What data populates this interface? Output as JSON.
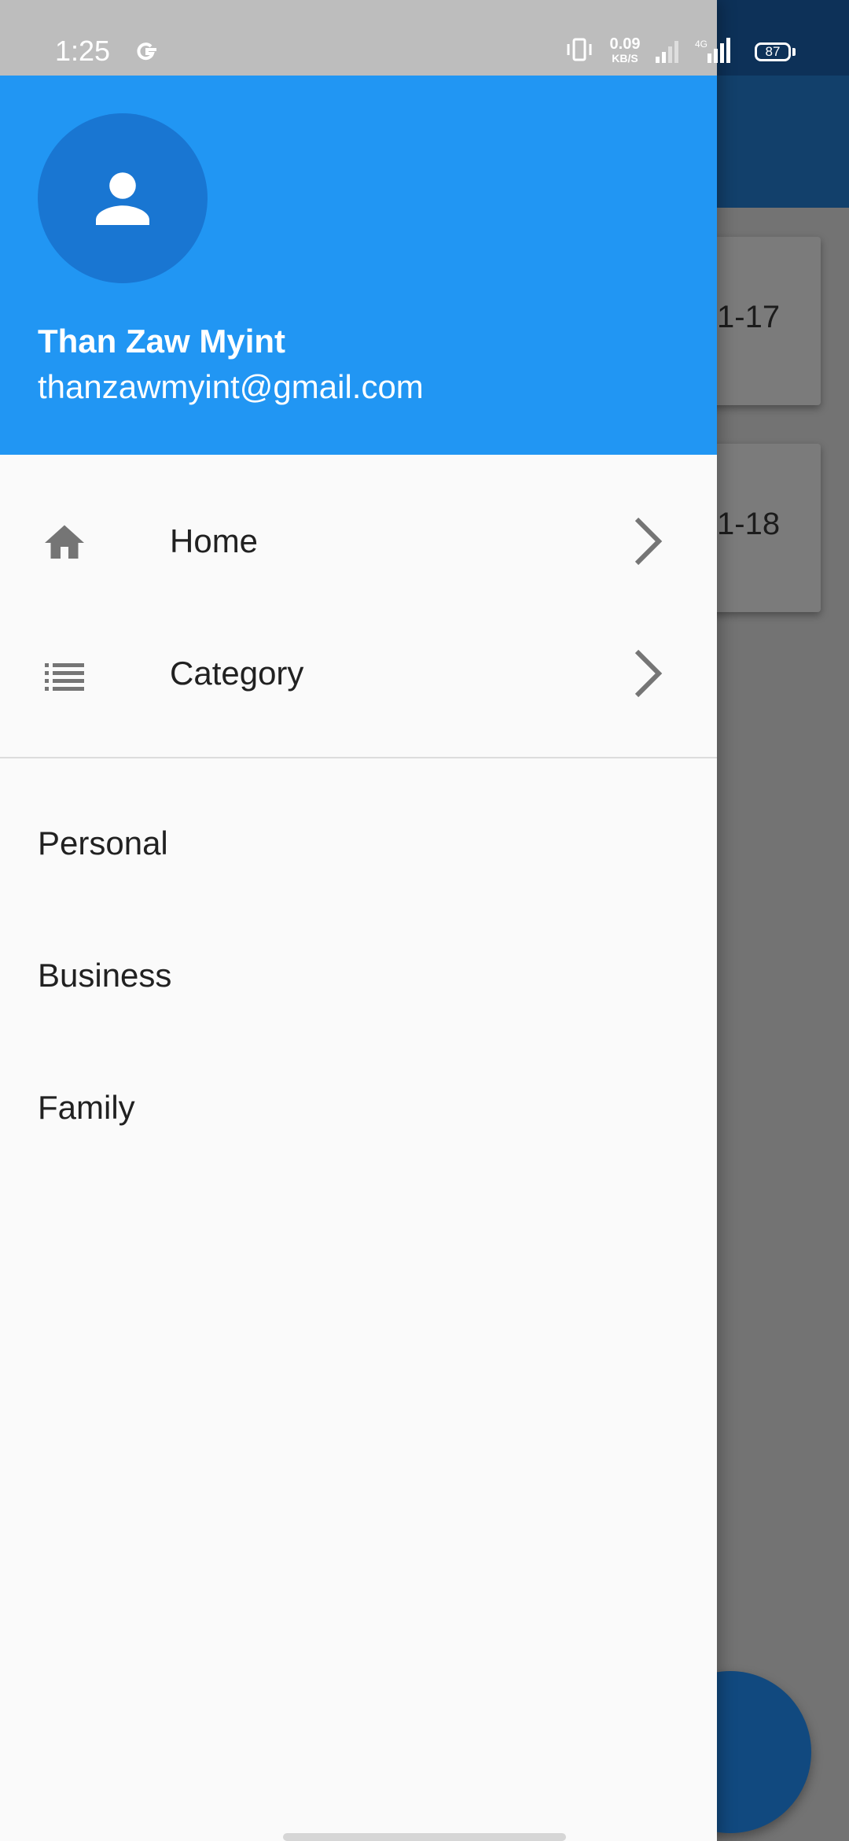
{
  "status_bar": {
    "time": "1:25",
    "net_speed_value": "0.09",
    "net_speed_unit": "KB/S",
    "network_type": "4G",
    "battery": "87"
  },
  "background": {
    "card_1_text": "1-17",
    "card_2_text": "1-18"
  },
  "drawer": {
    "header": {
      "name": "Than Zaw Myint",
      "email": "thanzawmyint@gmail.com"
    },
    "nav_items": [
      {
        "label": "Home",
        "icon": "home-icon"
      },
      {
        "label": "Category",
        "icon": "list-icon"
      }
    ],
    "categories": [
      {
        "label": "Personal"
      },
      {
        "label": "Business"
      },
      {
        "label": "Family"
      }
    ]
  },
  "colors": {
    "header": "#2196f3",
    "avatar": "#1976d2",
    "drawer_bg": "#fafafa",
    "status_bar": "#bdbdbd",
    "icon_grey": "#757575"
  }
}
